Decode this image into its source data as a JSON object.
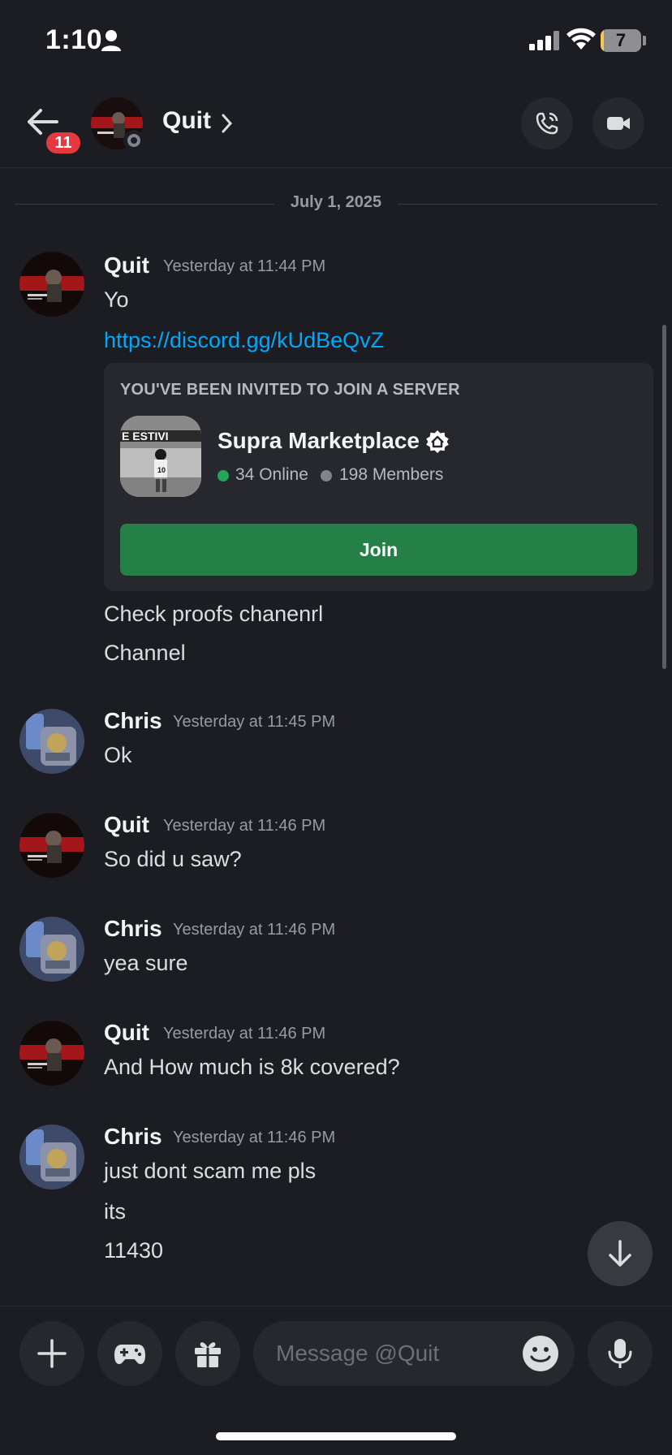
{
  "status_bar": {
    "time": "1:10",
    "battery_level": "7",
    "battery_fraction": 0.07
  },
  "header": {
    "unread_badge": "11",
    "title": "Quit",
    "icons": [
      "back-arrow-icon",
      "chevron-right-icon",
      "phone-call-icon",
      "video-camera-icon"
    ]
  },
  "date_divider": "July 1, 2025",
  "messages": [
    {
      "author": "Quit",
      "timestamp": "Yesterday at 11:44 PM",
      "lines": [
        "Yo"
      ],
      "link": "https://discord.gg/kUdBeQvZ",
      "after_invite": [
        "Check proofs chanenrl",
        "Channel"
      ]
    },
    {
      "author": "Chris",
      "timestamp": "Yesterday at 11:45 PM",
      "lines": [
        "Ok"
      ]
    },
    {
      "author": "Quit",
      "timestamp": "Yesterday at 11:46 PM",
      "lines": [
        "So did u saw?"
      ]
    },
    {
      "author": "Chris",
      "timestamp": "Yesterday at 11:46 PM",
      "lines": [
        "yea sure"
      ]
    },
    {
      "author": "Quit",
      "timestamp": "Yesterday at 11:46 PM",
      "lines": [
        "And How much is 8k covered?"
      ]
    },
    {
      "author": "Chris",
      "timestamp": "Yesterday at 11:46 PM",
      "lines": [
        "just dont scam me pls",
        "its",
        "11430"
      ]
    }
  ],
  "invite": {
    "heading": "YOU'VE BEEN INVITED TO JOIN A SERVER",
    "server_name": "Supra Marketplace",
    "online": "34 Online",
    "members": "198 Members",
    "join_label": "Join",
    "colors": {
      "online": "#23a55a",
      "join": "#248046"
    }
  },
  "composer": {
    "placeholder": "Message @Quit",
    "icons": [
      "plus-icon",
      "gamepad-icon",
      "gift-icon",
      "emoji-icon",
      "microphone-icon"
    ]
  },
  "colors": {
    "background": "#1c1d22",
    "link": "#00a8fc",
    "badge": "#e5383f"
  }
}
